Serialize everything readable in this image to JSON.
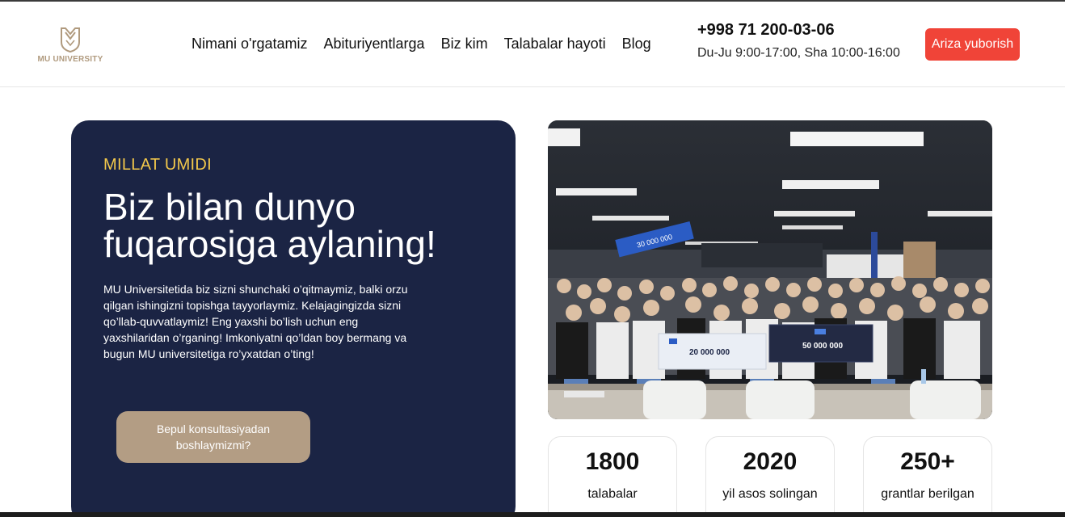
{
  "header": {
    "logo_text": "MU UNIVERSITY",
    "nav": [
      {
        "label": "Nimani o'rgatamiz"
      },
      {
        "label": "Abituriyentlarga"
      },
      {
        "label": "Biz kim"
      },
      {
        "label": "Talabalar hayoti"
      },
      {
        "label": "Blog"
      }
    ],
    "phone": "+998 71 200-03-06",
    "hours": "Du-Ju 9:00-17:00, Sha 10:00-16:00",
    "cta_label": "Ariza yuborish"
  },
  "hero": {
    "kicker": "MILLAT UMIDI",
    "title": "Biz bilan dunyo fuqarosiga aylaning!",
    "text": "MU Universitetida biz sizni shunchaki o’qitmaymiz, balki orzu qilgan ishingizni topishga tayyorlaymiz. Kelajagingizda sizni qo’llab-quvvatlaymiz! Eng yaxshi bo’lish uchun eng yaxshilaridan o’rganing! Imkoniyatni qo’ldan boy bermang va bugun MU universitetiga ro’yxatdan o’ting!",
    "button_label": "Bepul konsultasiyadan boshlaymizmi?"
  },
  "photo": {
    "check_left_amount": "20 000 000",
    "check_right_amount": "50 000 000",
    "banner_amount": "30 000 000"
  },
  "stats": [
    {
      "value": "1800",
      "label": "talabalar"
    },
    {
      "value": "2020",
      "label": "yil asos solingan"
    },
    {
      "value": "250+",
      "label": "grantlar berilgan"
    }
  ],
  "colors": {
    "accent_red": "#f04438",
    "navy": "#1b2444",
    "gold": "#f3c84b",
    "beige": "#b39d84"
  }
}
